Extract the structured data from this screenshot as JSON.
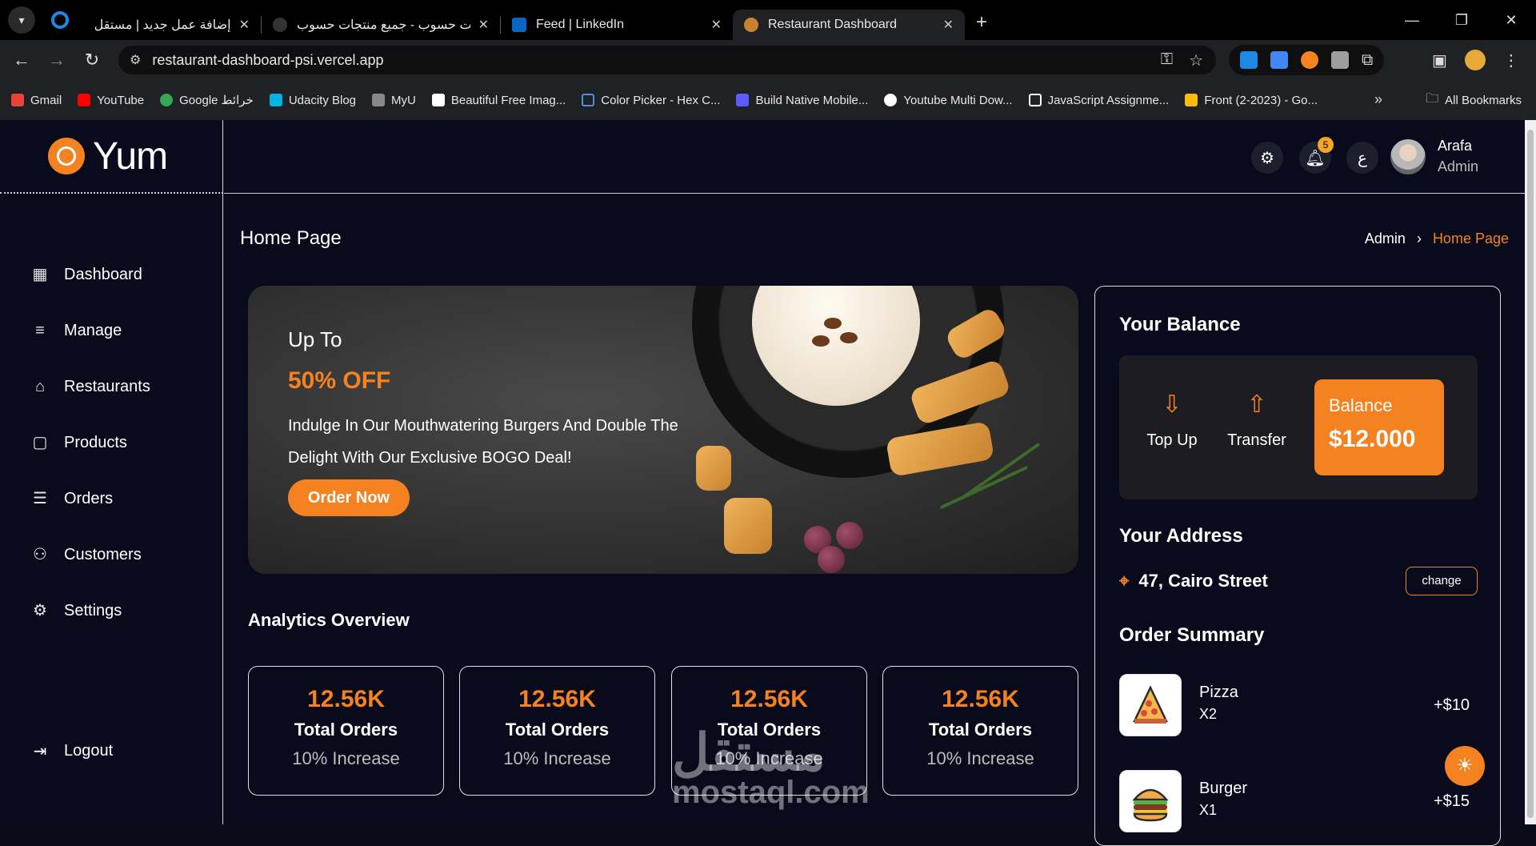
{
  "browser": {
    "tabs": [
      {
        "label": "إضافة عمل جديد | مستقل",
        "active": false
      },
      {
        "label": "حسابات حسوب - جميع منتجات حسوب",
        "active": false
      },
      {
        "label": "Feed | LinkedIn",
        "active": false
      },
      {
        "label": "Restaurant Dashboard",
        "active": true
      }
    ],
    "url": "restaurant-dashboard-psi.vercel.app",
    "bookmarks": [
      {
        "label": "Gmail",
        "color": "#ea4335"
      },
      {
        "label": "YouTube",
        "color": "#ff0000"
      },
      {
        "label": "Google خرائط",
        "color": "#34a853"
      },
      {
        "label": "Udacity Blog",
        "color": "#02b3e4"
      },
      {
        "label": "MyU",
        "color": "#888888"
      },
      {
        "label": "Beautiful Free Imag...",
        "color": "#ffffff"
      },
      {
        "label": "Color Picker - Hex C...",
        "color": "#4a90e2"
      },
      {
        "label": "Build Native Mobile...",
        "color": "#5b5bff"
      },
      {
        "label": "Youtube Multi Dow...",
        "color": "#ffffff"
      },
      {
        "label": "JavaScript Assignme...",
        "color": "#ffffff"
      },
      {
        "label": "Front (2-2023) - Go...",
        "color": "#fbbc04"
      }
    ],
    "all_bookmarks": "All Bookmarks"
  },
  "sidebar": {
    "logo": "Yum",
    "items": [
      {
        "label": "Dashboard",
        "icon": "grid-icon"
      },
      {
        "label": "Manage",
        "icon": "manage-icon"
      },
      {
        "label": "Restaurants",
        "icon": "restaurant-icon"
      },
      {
        "label": "Products",
        "icon": "bag-icon"
      },
      {
        "label": "Orders",
        "icon": "list-icon"
      },
      {
        "label": "Customers",
        "icon": "users-icon"
      },
      {
        "label": "Settings",
        "icon": "gear-icon"
      }
    ],
    "logout": "Logout"
  },
  "header": {
    "notifications": "5",
    "lang": "ع",
    "user_name": "Arafa",
    "user_role": "Admin"
  },
  "page": {
    "title": "Home Page",
    "breadcrumb_root": "Admin",
    "breadcrumb_current": "Home Page"
  },
  "hero": {
    "up_to": "Up To",
    "offer": "50% OFF",
    "description": "Indulge In Our Mouthwatering Burgers And Double The Delight With Our Exclusive BOGO Deal!",
    "button": "Order Now"
  },
  "analytics": {
    "title": "Analytics Overview",
    "cards": [
      {
        "value": "12.56K",
        "label": "Total Orders",
        "delta": "10% Increase"
      },
      {
        "value": "12.56K",
        "label": "Total Orders",
        "delta": "10% Increase"
      },
      {
        "value": "12.56K",
        "label": "Total Orders",
        "delta": "10% Increase"
      },
      {
        "value": "12.56K",
        "label": "Total Orders",
        "delta": "10% Increase"
      }
    ]
  },
  "balance": {
    "title": "Your Balance",
    "top_up": "Top Up",
    "transfer": "Transfer",
    "card_label": "Balance",
    "card_value": "$12.000"
  },
  "address": {
    "title": "Your Address",
    "value": "47, Cairo Street",
    "change": "change"
  },
  "order_summary": {
    "title": "Order Summary",
    "items": [
      {
        "name": "Pizza",
        "qty": "X2",
        "price": "+$10"
      },
      {
        "name": "Burger",
        "qty": "X1",
        "price": "+$15"
      }
    ]
  },
  "watermark": {
    "arabic": "مستقل",
    "latin": "mostaql.com"
  },
  "colors": {
    "accent": "#f58220",
    "background": "#090b1c"
  }
}
